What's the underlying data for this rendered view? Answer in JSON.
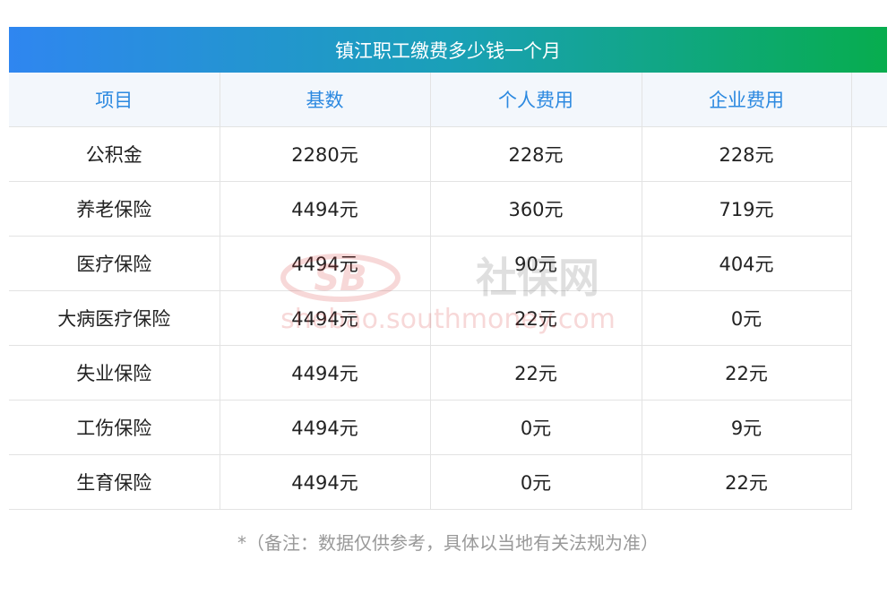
{
  "title": "镇江职工缴费多少钱一个月",
  "table": {
    "headers": [
      "项目",
      "基数",
      "个人费用",
      "企业费用"
    ],
    "rows": [
      [
        "公积金",
        "2280元",
        "228元",
        "228元"
      ],
      [
        "养老保险",
        "4494元",
        "360元",
        "719元"
      ],
      [
        "医疗保险",
        "4494元",
        "90元",
        "404元"
      ],
      [
        "大病医疗保险",
        "4494元",
        "22元",
        "0元"
      ],
      [
        "失业保险",
        "4494元",
        "22元",
        "22元"
      ],
      [
        "工伤保险",
        "4494元",
        "0元",
        "9元"
      ],
      [
        "生育保险",
        "4494元",
        "0元",
        "22元"
      ]
    ]
  },
  "note": "*（备注：数据仅供参考，具体以当地有关法规为准）",
  "watermark": {
    "logo": "SB",
    "brand": "社保网",
    "domain": "shebao.southmoney.com"
  },
  "colors": {
    "title_gradient_start": "#2f86f0",
    "title_gradient_end": "#07ad4e",
    "header_text": "#2c89e0",
    "header_bg": "#f3f7fc",
    "watermark": "#d62b2b"
  }
}
